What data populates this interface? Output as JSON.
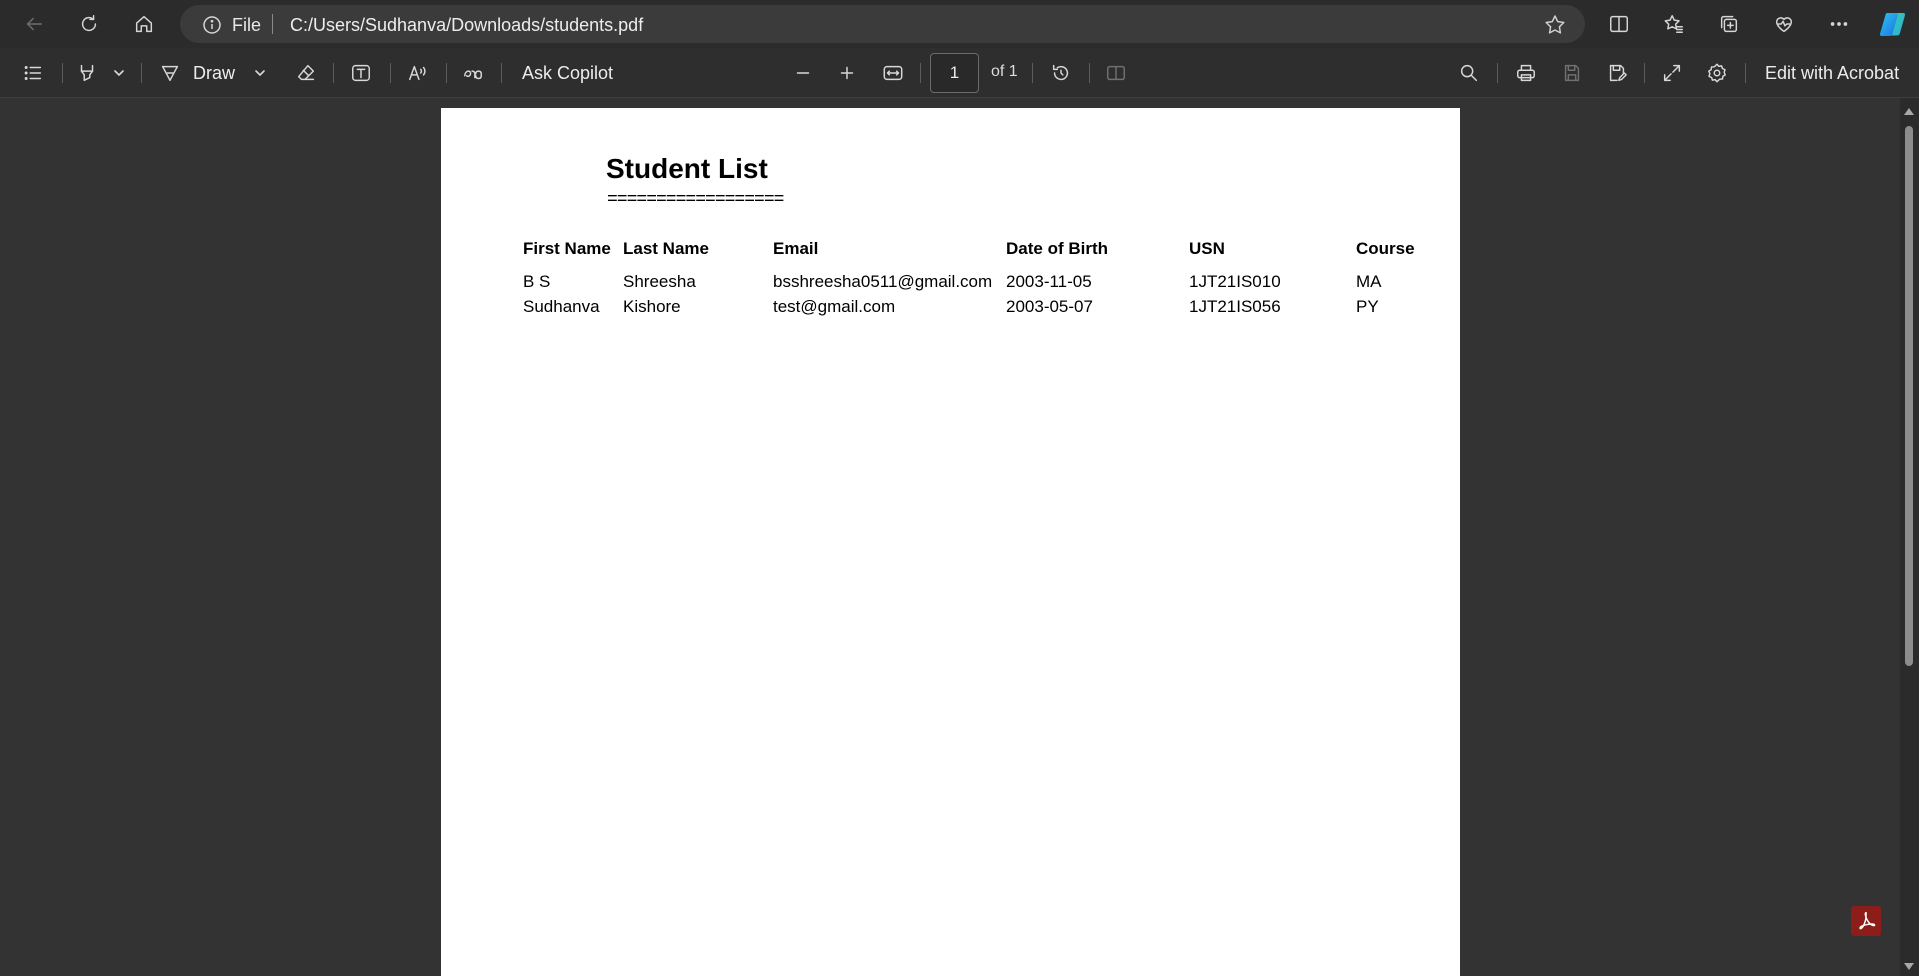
{
  "browser": {
    "address": {
      "scheme_label": "File",
      "url": "C:/Users/Sudhanva/Downloads/students.pdf"
    },
    "nav_icons": [
      "back-icon",
      "refresh-icon",
      "home-icon"
    ],
    "right_icons": [
      "split-screen-icon",
      "favorites-icon",
      "collections-icon",
      "browser-essentials-icon",
      "more-icon",
      "copilot-icon"
    ]
  },
  "pdf_toolbar": {
    "draw_label": "Draw",
    "ask_copilot_label": "Ask Copilot",
    "page_current": "1",
    "page_total_label": "of 1",
    "edit_acrobat_label": "Edit with Acrobat"
  },
  "document": {
    "title": "Student List",
    "title_rule": "==================",
    "columns": [
      "First Name",
      "Last Name",
      "Email",
      "Date of Birth",
      "USN",
      "Course"
    ],
    "rows": [
      [
        "B S",
        "Shreesha",
        "bsshreesha0511@gmail.com",
        "2003-11-05",
        "1JT21IS010",
        "MA"
      ],
      [
        "Sudhanva",
        "Kishore",
        "test@gmail.com",
        "2003-05-07",
        "1JT21IS056",
        "PY"
      ]
    ]
  },
  "colors": {
    "chrome_bg": "#2b2b2b",
    "viewer_bg": "#333333",
    "page_bg": "#ffffff",
    "acrobat_red": "#8c1d18"
  }
}
